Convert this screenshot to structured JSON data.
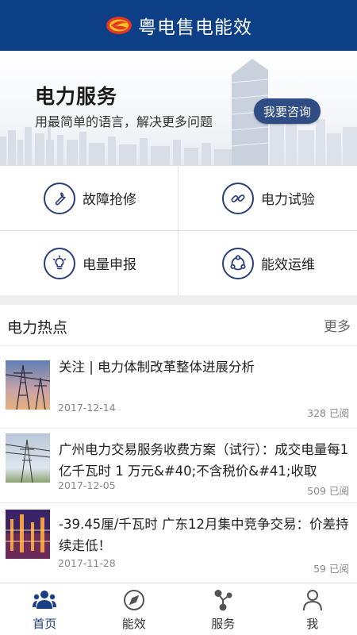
{
  "header": {
    "title": "粤电售电能效"
  },
  "banner": {
    "title": "电力服务",
    "subtitle": "用最简单的语言，解决更多问题",
    "button_label": "我要咨询"
  },
  "services": [
    {
      "label": "故障抢修",
      "icon": "wrench-icon"
    },
    {
      "label": "电力试验",
      "icon": "link-icon"
    },
    {
      "label": "电量申报",
      "icon": "lightbulb-icon"
    },
    {
      "label": "能效运维",
      "icon": "cycle-icon"
    }
  ],
  "news": {
    "title": "电力热点",
    "more_label": "更多",
    "items": [
      {
        "headline": "关注 | 电力体制改革整体进展分析",
        "date": "2017-12-14",
        "reads": "328 已阅"
      },
      {
        "headline": "广州电力交易服务收费方案（试行）：成交电量每1 亿千瓦时 1 万元&#40;不含税价&#41;收取",
        "date": "2017-12-05",
        "reads": "509 已阅"
      },
      {
        "headline": "-39.45厘/千瓦时 广东12月集中竞争交易：价差持续走低！",
        "date": "2017-11-28",
        "reads": "59 已阅"
      }
    ]
  },
  "tabbar": {
    "items": [
      {
        "label": "首页",
        "icon": "home-users-icon",
        "active": true
      },
      {
        "label": "能效",
        "icon": "compass-icon",
        "active": false
      },
      {
        "label": "服务",
        "icon": "nodes-icon",
        "active": false
      },
      {
        "label": "我",
        "icon": "person-icon",
        "active": false
      }
    ]
  },
  "colors": {
    "primary": "#0d3f87",
    "button": "#2f4d84",
    "icon_stroke": "#2a3f7a"
  }
}
